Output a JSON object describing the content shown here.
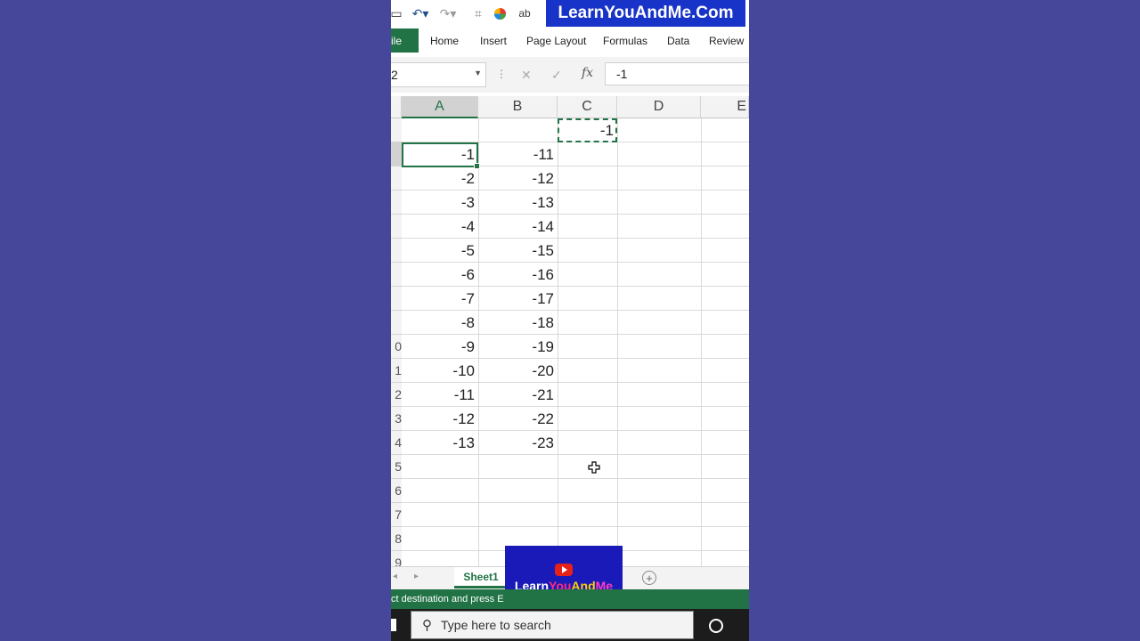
{
  "watermark": "LearnYouAndMe.Com",
  "ribbon": {
    "file": "ile",
    "tabs": [
      "Home",
      "Insert",
      "Page Layout",
      "Formulas",
      "Data",
      "Review"
    ]
  },
  "formula_bar": {
    "name_box": "2",
    "fx": "fx",
    "value": "-1"
  },
  "columns": [
    "A",
    "B",
    "C",
    "D",
    "E"
  ],
  "row_headers": [
    "",
    "",
    "",
    "",
    "",
    "",
    "",
    "",
    "",
    "0",
    "1",
    "2",
    "3",
    "4",
    "5",
    "6",
    "7",
    "8",
    "9"
  ],
  "cells": {
    "c1": "-1",
    "col_a": [
      "-1",
      "-2",
      "-3",
      "-4",
      "-5",
      "-6",
      "-7",
      "-8",
      "-9",
      "-10",
      "-11",
      "-12",
      "-13"
    ],
    "col_b": [
      "-11",
      "-12",
      "-13",
      "-14",
      "-15",
      "-16",
      "-17",
      "-18",
      "-19",
      "-20",
      "-21",
      "-22",
      "-23"
    ]
  },
  "sheet_tab": "Sheet1",
  "status_text": "ct destination and press E",
  "logo": {
    "part1": "Learn",
    "part2": "You",
    "part3": "And",
    "part4": "Me"
  },
  "taskbar": {
    "search_placeholder": "Type here to search"
  },
  "colors": {
    "excel_green": "#217346",
    "background": "#46469a",
    "watermark_bg": "#1833c7"
  }
}
